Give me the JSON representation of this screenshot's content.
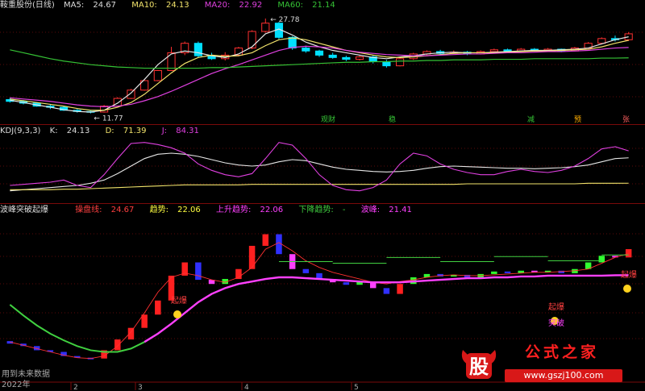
{
  "title_row": {
    "name": "鞍重股份(日线)",
    "ma5_label": "MA5:",
    "ma5": "24.67",
    "ma10_label": "MA10:",
    "ma10": "24.13",
    "ma20_label": "MA20:",
    "ma20": "22.92",
    "ma60_label": "MA60:",
    "ma60": "21.14",
    "high_label": "27.78",
    "low_label": "11.77",
    "signals": [
      "观财",
      "稳",
      "减",
      "预",
      "张"
    ]
  },
  "kdj_row": {
    "name": "KDJ(9,3,3)",
    "k_label": "K:",
    "k": "24.13",
    "d_label": "D:",
    "d": "71.39",
    "j_label": "J:",
    "j": "84.31"
  },
  "ind_row": {
    "name": "波峰突破起爆",
    "c_label": "操盘线:",
    "c": "24.67",
    "t_label": "趋势:",
    "t": "22.06",
    "u_label": "上升趋势:",
    "u": "22.06",
    "d_label": "下降趋势:",
    "d": "-",
    "p_label": "波峰:",
    "p": "21.41",
    "markers": [
      "起爆",
      "起爆",
      "起爆",
      "突破"
    ]
  },
  "footer": {
    "note": "用到未来数据",
    "year": "2022年",
    "months": [
      "2",
      "3",
      "4",
      "5"
    ]
  },
  "watermark": {
    "logo_char": "股",
    "text": "公式之家",
    "url": "www.gszj100.com"
  },
  "colors": {
    "up": "#ff3030",
    "down": "#00e0ff",
    "ma5": "#e6e6e6",
    "ma10": "#f2e36b",
    "ma20": "#e040e0",
    "ma60": "#35c235",
    "k": "#e6e6e6",
    "d": "#f2e36b",
    "j": "#e040e0",
    "trend_up": "#ff40ff",
    "trend_green": "#40d040",
    "trend_yellow": "#ffff40",
    "bar_red": "#ff2020",
    "bar_green": "#30ff30",
    "bar_blue": "#3030ff",
    "bar_magenta": "#ff40ff"
  },
  "chart_data": [
    {
      "type": "candlestick",
      "title": "鞍重股份(日线)",
      "ylim": [
        10.5,
        29
      ],
      "series": [
        {
          "name": "MA5",
          "values": [
            14.0,
            13.6,
            13.2,
            12.8,
            12.4,
            12.1,
            12.0,
            12.3,
            13.5,
            15.2,
            17.5,
            20.0,
            21.8,
            22.3,
            22.0,
            21.5,
            21.2,
            21.8,
            23.0,
            25.2,
            26.0,
            25.0,
            23.8,
            23.0,
            22.4,
            22.0,
            21.6,
            21.2,
            21.0,
            21.3,
            21.5,
            21.8,
            22.0,
            22.1,
            22.0,
            22.0,
            22.1,
            22.2,
            22.3,
            22.4,
            22.4,
            22.5,
            22.6,
            22.8,
            23.5,
            24.2,
            24.7
          ]
        },
        {
          "name": "MA10",
          "values": [
            14.2,
            13.9,
            13.6,
            13.3,
            13.0,
            12.6,
            12.3,
            12.3,
            12.8,
            13.6,
            15.0,
            16.8,
            18.6,
            20.2,
            21.2,
            21.6,
            21.4,
            21.5,
            22.0,
            23.2,
            24.2,
            24.5,
            24.2,
            23.6,
            23.0,
            22.4,
            22.0,
            21.6,
            21.3,
            21.2,
            21.3,
            21.5,
            21.7,
            21.9,
            22.0,
            22.0,
            22.0,
            22.1,
            22.2,
            22.3,
            22.3,
            22.4,
            22.5,
            22.6,
            23.0,
            23.6,
            24.1
          ]
        },
        {
          "name": "MA20",
          "values": [
            14.4,
            14.2,
            14.0,
            13.8,
            13.5,
            13.2,
            13.0,
            12.9,
            13.0,
            13.3,
            13.9,
            14.6,
            15.5,
            16.5,
            17.5,
            18.5,
            19.3,
            20.0,
            20.8,
            21.6,
            22.4,
            22.9,
            23.1,
            23.0,
            22.8,
            22.4,
            22.1,
            21.9,
            21.7,
            21.6,
            21.5,
            21.5,
            21.6,
            21.7,
            21.8,
            21.8,
            21.9,
            22.0,
            22.0,
            22.1,
            22.2,
            22.2,
            22.3,
            22.4,
            22.6,
            22.8,
            22.9
          ]
        },
        {
          "name": "MA60",
          "values": [
            22.5,
            22.0,
            21.5,
            21.0,
            20.6,
            20.3,
            20.0,
            19.8,
            19.6,
            19.5,
            19.4,
            19.4,
            19.4,
            19.4,
            19.4,
            19.5,
            19.5,
            19.6,
            19.7,
            19.8,
            19.9,
            20.0,
            20.1,
            20.2,
            20.3,
            20.4,
            20.4,
            20.5,
            20.5,
            20.6,
            20.6,
            20.7,
            20.7,
            20.8,
            20.8,
            20.8,
            20.9,
            20.9,
            20.9,
            21.0,
            21.0,
            21.0,
            21.0,
            21.0,
            21.1,
            21.1,
            21.14
          ]
        }
      ],
      "candles": [
        {
          "o": 14.1,
          "c": 13.8,
          "h": 14.4,
          "l": 13.6
        },
        {
          "o": 13.8,
          "c": 13.5,
          "h": 14.0,
          "l": 13.3
        },
        {
          "o": 13.5,
          "c": 13.0,
          "h": 13.7,
          "l": 12.9
        },
        {
          "o": 13.0,
          "c": 12.8,
          "h": 13.3,
          "l": 12.5
        },
        {
          "o": 12.8,
          "c": 12.3,
          "h": 13.0,
          "l": 12.2
        },
        {
          "o": 12.3,
          "c": 12.1,
          "h": 12.5,
          "l": 11.9
        },
        {
          "o": 12.1,
          "c": 12.0,
          "h": 12.2,
          "l": 11.77
        },
        {
          "o": 12.0,
          "c": 13.0,
          "h": 13.2,
          "l": 11.9
        },
        {
          "o": 13.0,
          "c": 14.3,
          "h": 14.5,
          "l": 12.9
        },
        {
          "o": 14.3,
          "c": 15.7,
          "h": 15.9,
          "l": 14.2
        },
        {
          "o": 15.7,
          "c": 17.3,
          "h": 17.4,
          "l": 15.6
        },
        {
          "o": 17.3,
          "c": 19.0,
          "h": 19.1,
          "l": 17.2
        },
        {
          "o": 19.0,
          "c": 22.0,
          "h": 23.0,
          "l": 19.0
        },
        {
          "o": 22.0,
          "c": 23.6,
          "h": 23.9,
          "l": 21.6
        },
        {
          "o": 23.6,
          "c": 21.5,
          "h": 23.9,
          "l": 21.2
        },
        {
          "o": 21.5,
          "c": 21.0,
          "h": 22.0,
          "l": 20.8
        },
        {
          "o": 21.0,
          "c": 21.6,
          "h": 22.1,
          "l": 20.7
        },
        {
          "o": 21.6,
          "c": 22.8,
          "h": 23.0,
          "l": 21.4
        },
        {
          "o": 22.8,
          "c": 25.6,
          "h": 25.8,
          "l": 22.6
        },
        {
          "o": 25.6,
          "c": 27.0,
          "h": 27.78,
          "l": 25.4
        },
        {
          "o": 27.0,
          "c": 24.6,
          "h": 27.2,
          "l": 24.3
        },
        {
          "o": 24.6,
          "c": 22.8,
          "h": 24.8,
          "l": 22.5
        },
        {
          "o": 22.8,
          "c": 22.3,
          "h": 23.2,
          "l": 22.0
        },
        {
          "o": 22.3,
          "c": 21.6,
          "h": 22.5,
          "l": 21.3
        },
        {
          "o": 21.6,
          "c": 21.2,
          "h": 22.0,
          "l": 21.0
        },
        {
          "o": 21.2,
          "c": 20.9,
          "h": 21.5,
          "l": 20.6
        },
        {
          "o": 20.9,
          "c": 21.3,
          "h": 21.5,
          "l": 20.7
        },
        {
          "o": 21.3,
          "c": 20.5,
          "h": 21.5,
          "l": 20.2
        },
        {
          "o": 20.5,
          "c": 19.8,
          "h": 20.8,
          "l": 19.5
        },
        {
          "o": 19.8,
          "c": 21.0,
          "h": 21.2,
          "l": 19.7
        },
        {
          "o": 21.0,
          "c": 21.8,
          "h": 22.0,
          "l": 20.8
        },
        {
          "o": 21.8,
          "c": 22.2,
          "h": 22.4,
          "l": 21.6
        },
        {
          "o": 22.2,
          "c": 21.9,
          "h": 22.5,
          "l": 21.7
        },
        {
          "o": 21.9,
          "c": 22.1,
          "h": 22.4,
          "l": 21.8
        },
        {
          "o": 22.1,
          "c": 21.8,
          "h": 22.3,
          "l": 21.6
        },
        {
          "o": 21.8,
          "c": 22.2,
          "h": 22.4,
          "l": 21.7
        },
        {
          "o": 22.2,
          "c": 22.5,
          "h": 22.7,
          "l": 22.0
        },
        {
          "o": 22.5,
          "c": 22.3,
          "h": 22.7,
          "l": 22.1
        },
        {
          "o": 22.3,
          "c": 22.6,
          "h": 22.8,
          "l": 22.2
        },
        {
          "o": 22.6,
          "c": 22.4,
          "h": 22.8,
          "l": 22.2
        },
        {
          "o": 22.4,
          "c": 22.6,
          "h": 22.8,
          "l": 22.3
        },
        {
          "o": 22.6,
          "c": 22.3,
          "h": 22.7,
          "l": 22.1
        },
        {
          "o": 22.3,
          "c": 22.8,
          "h": 23.0,
          "l": 22.2
        },
        {
          "o": 22.8,
          "c": 23.6,
          "h": 23.8,
          "l": 22.7
        },
        {
          "o": 23.6,
          "c": 24.4,
          "h": 24.6,
          "l": 23.4
        },
        {
          "o": 24.4,
          "c": 24.2,
          "h": 24.9,
          "l": 23.9
        },
        {
          "o": 24.2,
          "c": 25.2,
          "h": 25.5,
          "l": 24.0
        }
      ]
    },
    {
      "type": "line",
      "title": "KDJ(9,3,3)",
      "ylim": [
        -10,
        110
      ],
      "series": [
        {
          "name": "K",
          "values": [
            10,
            12,
            14,
            16,
            18,
            20,
            24,
            30,
            42,
            56,
            70,
            78,
            80,
            78,
            74,
            68,
            62,
            58,
            56,
            58,
            64,
            68,
            66,
            60,
            54,
            50,
            48,
            46,
            45,
            46,
            48,
            52,
            55,
            56,
            55,
            54,
            53,
            52,
            52,
            51,
            52,
            53,
            55,
            58,
            64,
            70,
            71.39
          ]
        },
        {
          "name": "D",
          "values": [
            12,
            12,
            12,
            12,
            13,
            13,
            14,
            15,
            16,
            17,
            18,
            19,
            20,
            21,
            21,
            21,
            21,
            21,
            22,
            22,
            22,
            22,
            22,
            22,
            22,
            22,
            22,
            22,
            22,
            22,
            22,
            22,
            22,
            22,
            23,
            23,
            23,
            23,
            23,
            23,
            23,
            23,
            23,
            24,
            24,
            24,
            24.13
          ]
        },
        {
          "name": "J",
          "values": [
            20,
            22,
            24,
            26,
            30,
            20,
            16,
            40,
            70,
            98,
            100,
            96,
            90,
            80,
            60,
            48,
            40,
            36,
            42,
            70,
            100,
            95,
            70,
            40,
            20,
            12,
            10,
            16,
            30,
            60,
            80,
            75,
            60,
            50,
            44,
            40,
            40,
            46,
            50,
            46,
            44,
            48,
            56,
            70,
            88,
            92,
            84.31
          ]
        }
      ]
    },
    {
      "type": "bar",
      "title": "波峰突破起爆",
      "ylim": [
        11,
        29
      ],
      "series": [
        {
          "name": "操盘线",
          "values": [
            14.0,
            13.6,
            13.2,
            12.8,
            12.4,
            12.1,
            12.0,
            12.3,
            13.5,
            15.2,
            17.5,
            20.0,
            21.8,
            22.3,
            22.0,
            21.5,
            21.2,
            21.8,
            23.0,
            25.2,
            26.0,
            25.0,
            23.8,
            23.0,
            22.4,
            22.0,
            21.6,
            21.2,
            21.0,
            21.3,
            21.5,
            21.8,
            22.0,
            22.1,
            22.0,
            22.0,
            22.1,
            22.2,
            22.3,
            22.4,
            22.4,
            22.5,
            22.6,
            22.8,
            23.5,
            24.2,
            24.67
          ]
        },
        {
          "name": "趋势",
          "values": [
            18.5,
            17.2,
            16.0,
            15.0,
            14.2,
            13.5,
            13.0,
            12.8,
            12.8,
            13.2,
            14.0,
            15.0,
            16.2,
            17.5,
            18.8,
            19.8,
            20.5,
            21.0,
            21.3,
            21.6,
            21.8,
            21.8,
            21.7,
            21.6,
            21.5,
            21.4,
            21.3,
            21.2,
            21.2,
            21.2,
            21.3,
            21.4,
            21.5,
            21.6,
            21.7,
            21.7,
            21.8,
            21.8,
            21.9,
            21.9,
            22.0,
            22.0,
            22.0,
            22.0,
            22.0,
            22.05,
            22.06
          ]
        },
        {
          "name": "波峰",
          "values": [
            null,
            null,
            null,
            null,
            null,
            null,
            null,
            null,
            null,
            null,
            null,
            null,
            null,
            null,
            null,
            null,
            null,
            null,
            20.2,
            20.4,
            20.6,
            20.8,
            20.9,
            20.9,
            21.0,
            21.0,
            21.0,
            21.0,
            21.1,
            21.1,
            21.1,
            21.1,
            21.2,
            21.2,
            21.2,
            21.2,
            21.2,
            21.3,
            21.3,
            21.3,
            21.3,
            21.3,
            21.3,
            21.4,
            21.4,
            21.4,
            21.41
          ]
        }
      ]
    }
  ]
}
